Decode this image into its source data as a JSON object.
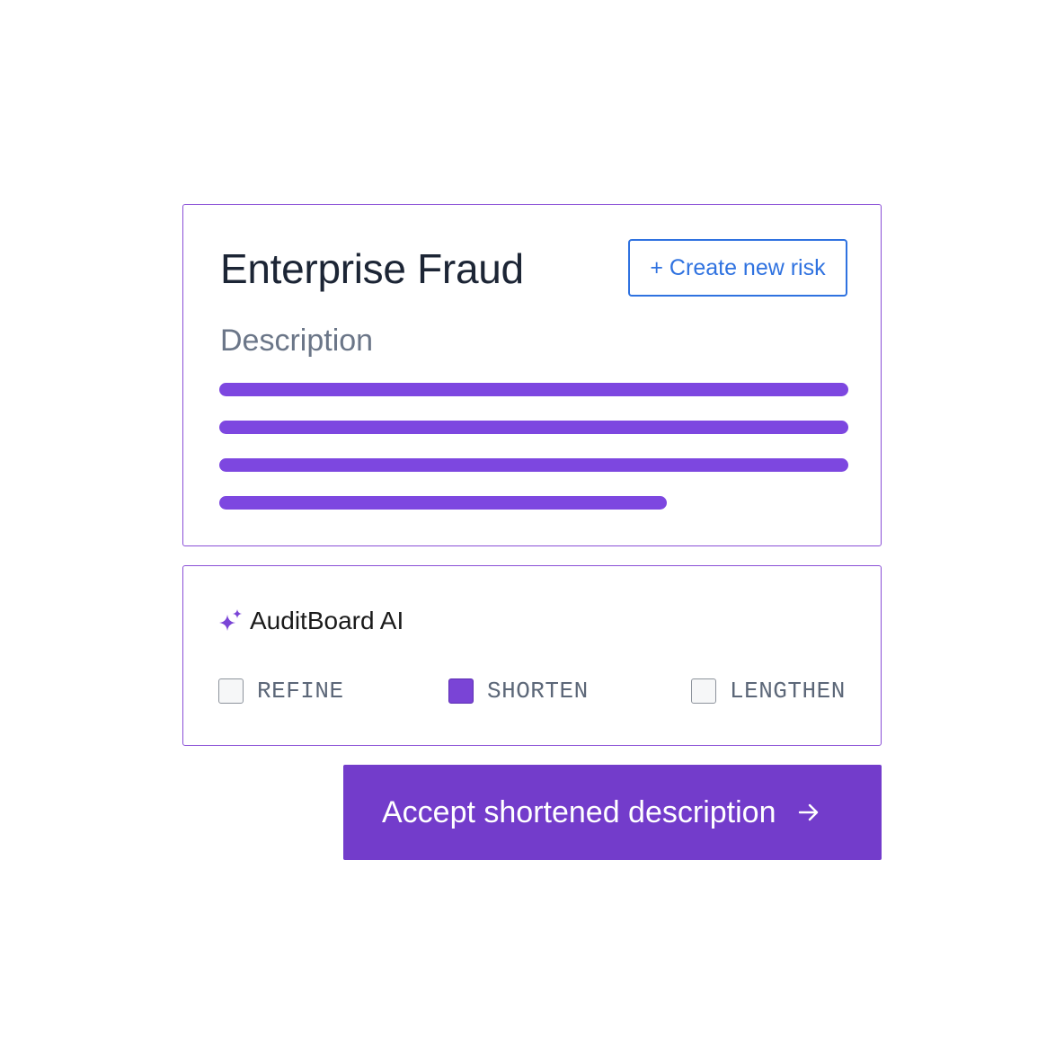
{
  "risk_card": {
    "title": "Enterprise Fraud",
    "create_button_label": "+ Create new risk",
    "description_label": "Description"
  },
  "ai_panel": {
    "title": "AuditBoard AI",
    "icon": "sparkle-icon",
    "options": [
      {
        "label": "REFINE",
        "checked": false
      },
      {
        "label": "SHORTEN",
        "checked": true
      },
      {
        "label": "LENGTHEN",
        "checked": false
      }
    ]
  },
  "accept_button": {
    "label": "Accept shortened description",
    "icon": "arrow-right-icon"
  },
  "colors": {
    "accent_purple": "#733ccb",
    "text_line_purple": "#7d47e0",
    "link_blue": "#2f72e0",
    "border_purple": "#8a4fd6"
  }
}
